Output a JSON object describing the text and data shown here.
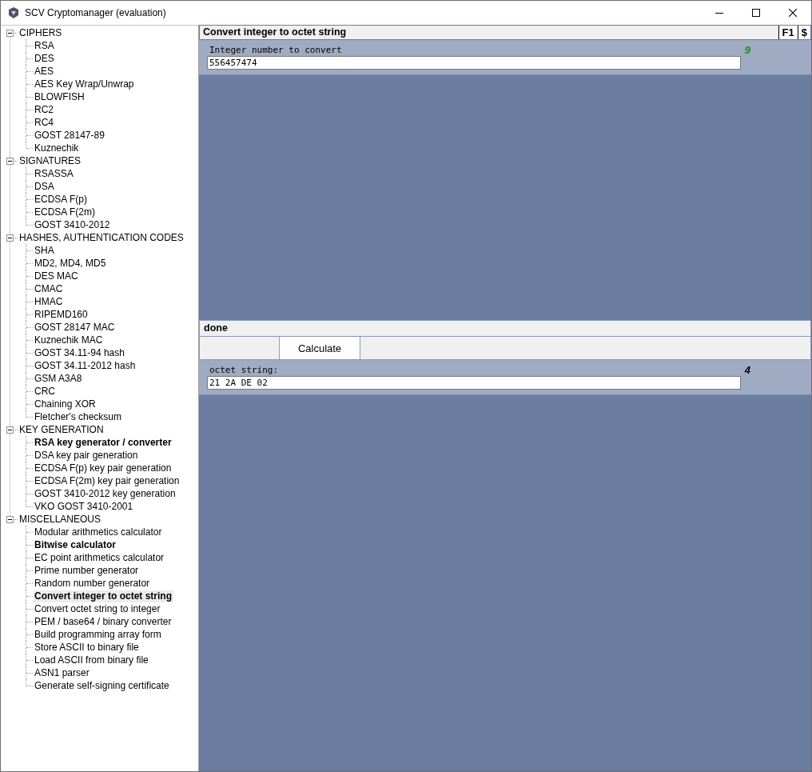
{
  "window": {
    "title": "SCV Cryptomanager (evaluation)"
  },
  "tree": [
    {
      "label": "CIPHERS",
      "expanded": true,
      "children": [
        {
          "label": "RSA",
          "bold": false,
          "selected": false
        },
        {
          "label": "DES",
          "bold": false,
          "selected": false
        },
        {
          "label": "AES",
          "bold": false,
          "selected": false
        },
        {
          "label": "AES Key Wrap/Unwrap",
          "bold": false,
          "selected": false
        },
        {
          "label": "BLOWFISH",
          "bold": false,
          "selected": false
        },
        {
          "label": "RC2",
          "bold": false,
          "selected": false
        },
        {
          "label": "RC4",
          "bold": false,
          "selected": false
        },
        {
          "label": "GOST 28147-89",
          "bold": false,
          "selected": false
        },
        {
          "label": "Kuznechik",
          "bold": false,
          "selected": false
        }
      ]
    },
    {
      "label": "SIGNATURES",
      "expanded": true,
      "children": [
        {
          "label": "RSASSA",
          "bold": false,
          "selected": false
        },
        {
          "label": "DSA",
          "bold": false,
          "selected": false
        },
        {
          "label": "ECDSA F(p)",
          "bold": false,
          "selected": false
        },
        {
          "label": "ECDSA F(2m)",
          "bold": false,
          "selected": false
        },
        {
          "label": "GOST 3410-2012",
          "bold": false,
          "selected": false
        }
      ]
    },
    {
      "label": "HASHES, AUTHENTICATION CODES",
      "expanded": true,
      "children": [
        {
          "label": "SHA",
          "bold": false,
          "selected": false
        },
        {
          "label": "MD2, MD4, MD5",
          "bold": false,
          "selected": false
        },
        {
          "label": "DES MAC",
          "bold": false,
          "selected": false
        },
        {
          "label": "CMAC",
          "bold": false,
          "selected": false
        },
        {
          "label": "HMAC",
          "bold": false,
          "selected": false
        },
        {
          "label": "RIPEMD160",
          "bold": false,
          "selected": false
        },
        {
          "label": "GOST 28147 MAC",
          "bold": false,
          "selected": false
        },
        {
          "label": "Kuznechik MAC",
          "bold": false,
          "selected": false
        },
        {
          "label": "GOST 34.11-94 hash",
          "bold": false,
          "selected": false
        },
        {
          "label": "GOST 34.11-2012 hash",
          "bold": false,
          "selected": false
        },
        {
          "label": "GSM A3A8",
          "bold": false,
          "selected": false
        },
        {
          "label": "CRC",
          "bold": false,
          "selected": false
        },
        {
          "label": "Chaining XOR",
          "bold": false,
          "selected": false
        },
        {
          "label": "Fletcher's checksum",
          "bold": false,
          "selected": false
        }
      ]
    },
    {
      "label": "KEY GENERATION",
      "expanded": true,
      "children": [
        {
          "label": "RSA key generator / converter",
          "bold": true,
          "selected": false
        },
        {
          "label": "DSA key pair generation",
          "bold": false,
          "selected": false
        },
        {
          "label": "ECDSA F(p) key pair generation",
          "bold": false,
          "selected": false
        },
        {
          "label": "ECDSA F(2m) key pair generation",
          "bold": false,
          "selected": false
        },
        {
          "label": "GOST 3410-2012 key generation",
          "bold": false,
          "selected": false
        },
        {
          "label": "VKO GOST 3410-2001",
          "bold": false,
          "selected": false
        }
      ]
    },
    {
      "label": "MISCELLANEOUS",
      "expanded": true,
      "children": [
        {
          "label": "Modular arithmetics calculator",
          "bold": false,
          "selected": false
        },
        {
          "label": "Bitwise calculator",
          "bold": true,
          "selected": false
        },
        {
          "label": "EC point arithmetics calculator",
          "bold": false,
          "selected": false
        },
        {
          "label": "Prime number generator",
          "bold": false,
          "selected": false
        },
        {
          "label": "Random number generator",
          "bold": false,
          "selected": false
        },
        {
          "label": "Convert integer to octet string",
          "bold": true,
          "selected": true
        },
        {
          "label": "Convert octet string to integer",
          "bold": false,
          "selected": false
        },
        {
          "label": "PEM / base64 / binary converter",
          "bold": false,
          "selected": false
        },
        {
          "label": "Build programming array form",
          "bold": false,
          "selected": false
        },
        {
          "label": "Store ASCII to binary file",
          "bold": false,
          "selected": false
        },
        {
          "label": "Load ASCII from binary file",
          "bold": false,
          "selected": false
        },
        {
          "label": "ASN1 parser",
          "bold": false,
          "selected": false
        },
        {
          "label": "Generate self-signing certificate",
          "bold": false,
          "selected": false
        }
      ]
    }
  ],
  "panel": {
    "title": "Convert integer to octet string",
    "header_buttons": [
      "F1",
      "$"
    ],
    "input": {
      "label": "Integer number to convert",
      "value": "556457474",
      "count": "9",
      "color": "#0a9a0a"
    },
    "status": "done",
    "button": "Calculate",
    "output": {
      "label": "octet string:",
      "value": "21 2A DE 02",
      "count": "4",
      "color": "#000000"
    }
  }
}
